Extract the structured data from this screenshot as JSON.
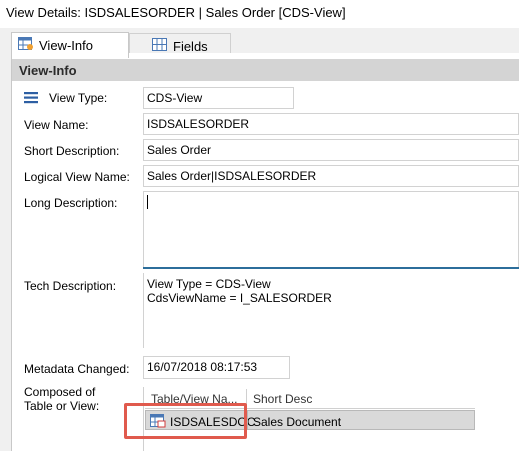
{
  "title": "View Details: ISDSALESORDER | Sales Order [CDS-View]",
  "tabs": [
    {
      "label": "View-Info",
      "icon": "table-info-icon",
      "active": true
    },
    {
      "label": "Fields",
      "icon": "fields-grid-icon",
      "active": false
    }
  ],
  "section": {
    "title": "View-Info"
  },
  "form": {
    "view_type": {
      "label": "View Type:",
      "value": "CDS-View",
      "icon": "list-lines-icon"
    },
    "view_name": {
      "label": "View Name:",
      "value": "ISDSALESORDER"
    },
    "short_description": {
      "label": "Short Description:",
      "value": "Sales Order"
    },
    "logical_view_name": {
      "label": "Logical View Name:",
      "value": "Sales Order|ISDSALESORDER"
    },
    "long_description": {
      "label": "Long Description:",
      "value": ""
    },
    "tech_description": {
      "label": "Tech Description:",
      "line1": "View Type = CDS-View",
      "line2": "CdsViewName = I_SALESORDER"
    },
    "metadata_changed": {
      "label": "Metadata Changed:",
      "value": "16/07/2018 08:17:53"
    },
    "composed_of": {
      "label_line1": "Composed of",
      "label_line2": "Table or View:"
    }
  },
  "composed_grid": {
    "columns": [
      "Table/View Na...",
      "Short Desc"
    ],
    "rows": [
      {
        "table_view": "ISDSALESDOC",
        "short_desc": "Sales Document",
        "icon": "table-icon"
      }
    ]
  },
  "colors": {
    "accent_line": "#2c6e9b",
    "highlight": "#e05a4d",
    "section_bg": "#d4d4d4"
  }
}
